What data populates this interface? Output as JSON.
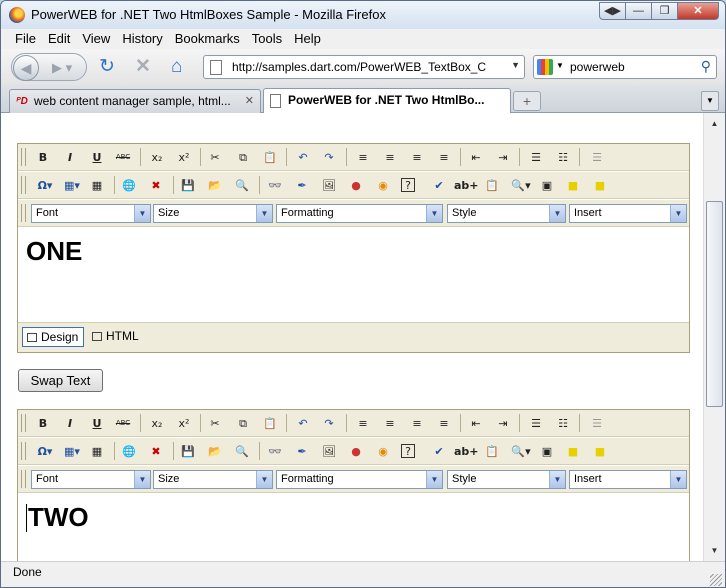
{
  "window": {
    "title": "PowerWEB for .NET Two HtmlBoxes Sample - Mozilla Firefox",
    "buttons": [
      "◀▶",
      "—",
      "❐",
      "✕"
    ]
  },
  "menu": [
    "File",
    "Edit",
    "View",
    "History",
    "Bookmarks",
    "Tools",
    "Help"
  ],
  "nav": {
    "url": "http://samples.dart.com/PowerWEB_TextBox_C",
    "search_value": "powerweb"
  },
  "tabs": [
    {
      "label": "web content manager sample, html..."
    },
    {
      "label": "PowerWEB for .NET Two HtmlBo..."
    }
  ],
  "editor_toolbar": {
    "row1": [
      "B",
      "I",
      "U",
      "ABC",
      "x₂",
      "x²",
      "✂",
      "⧉",
      "📋",
      "↶",
      "↷",
      "≡",
      "≡",
      "≡",
      "≡",
      "⇤",
      "⇥",
      "☰",
      "☷",
      "☰"
    ],
    "row2": [
      "Ω▾",
      "▦▾",
      "▦",
      "🌐",
      "✖",
      "💾",
      "📂",
      "🔍",
      "👓",
      "✒",
      "🖼",
      "●",
      "◉",
      "?",
      "✔",
      "ab+",
      "📋",
      "🔍▾",
      "▣",
      "■",
      "■"
    ],
    "dropdowns": [
      "Font",
      "Size",
      "Formatting",
      "Style",
      "Insert"
    ]
  },
  "editor1": {
    "content": "ONE",
    "modes": [
      "Design",
      "HTML"
    ]
  },
  "swap_button": "Swap Text",
  "editor2": {
    "content": "TWO"
  },
  "status": "Done"
}
